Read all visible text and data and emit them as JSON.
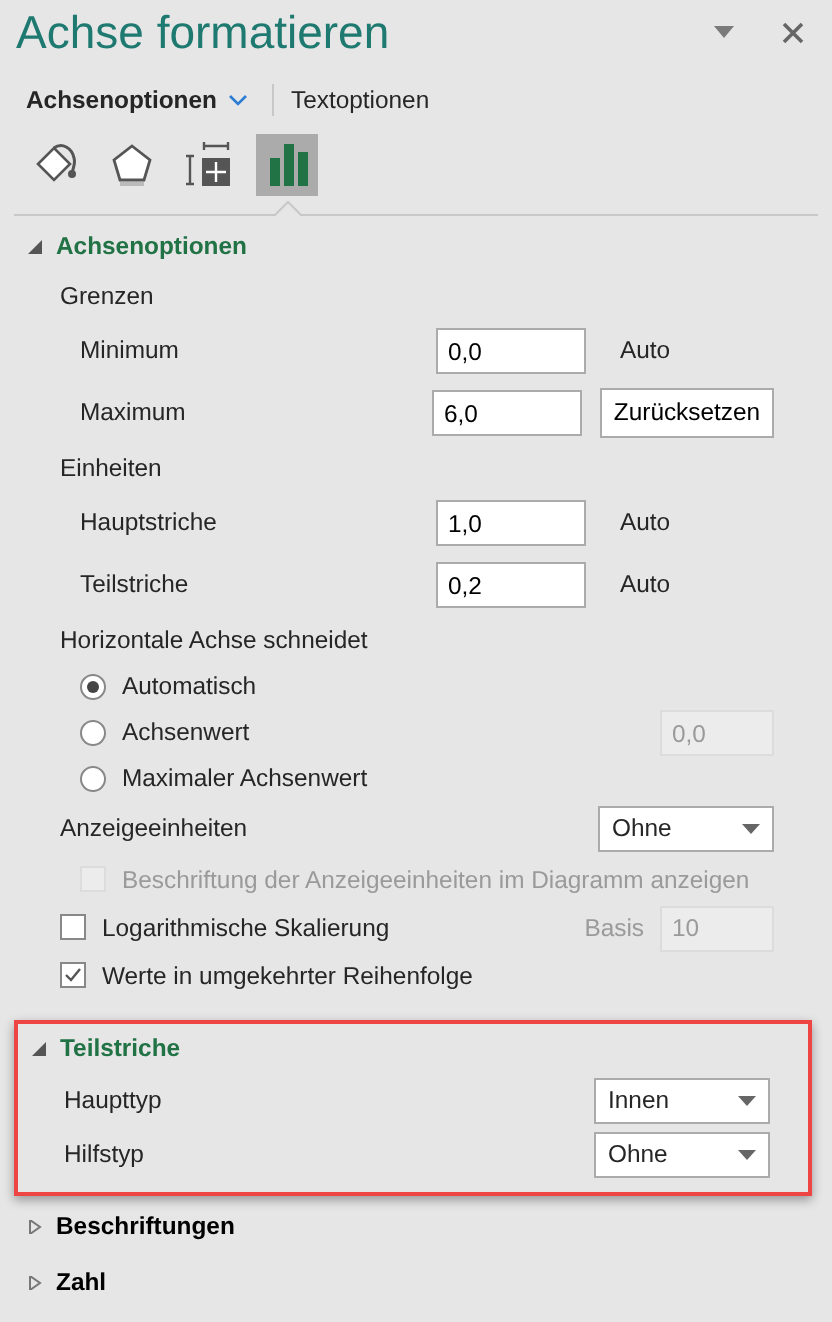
{
  "pane": {
    "title": "Achse formatieren",
    "tabs": [
      {
        "label": "Achsenoptionen",
        "selected": true
      },
      {
        "label": "Textoptionen",
        "selected": false
      }
    ],
    "icon_tabs": [
      {
        "kind": "fill",
        "selected": false
      },
      {
        "kind": "effects",
        "selected": false
      },
      {
        "kind": "size",
        "selected": false
      },
      {
        "kind": "axis",
        "selected": true
      }
    ]
  },
  "sections": [
    {
      "title": "Achsenoptionen",
      "expanded": true,
      "highlighted": false,
      "rows": [
        {
          "kind": "heading",
          "label": "Grenzen"
        },
        {
          "kind": "number",
          "label": "Minimum",
          "value": "0,0",
          "note": "Auto"
        },
        {
          "kind": "number",
          "label": "Maximum",
          "value": "6,0",
          "button": "Zurücksetzen"
        },
        {
          "kind": "heading",
          "label": "Einheiten"
        },
        {
          "kind": "number",
          "label": "Hauptstriche",
          "value": "1,0",
          "note": "Auto"
        },
        {
          "kind": "number",
          "label": "Teilstriche",
          "value": "0,2",
          "note": "Auto"
        },
        {
          "kind": "heading",
          "label": "Horizontale Achse schneidet"
        },
        {
          "kind": "radio",
          "label": "Automatisch",
          "selected": true
        },
        {
          "kind": "radio",
          "label": "Achsenwert",
          "selected": false,
          "field": "0,0"
        },
        {
          "kind": "radio",
          "label": "Maximaler Achsenwert",
          "selected": false
        },
        {
          "kind": "select",
          "label": "Anzeigeeinheiten",
          "value": "Ohne"
        },
        {
          "kind": "checkbox",
          "label": "Beschriftung der Anzeigeeinheiten im Diagramm anzeigen",
          "checked": false,
          "disabled": true
        },
        {
          "kind": "checkbox",
          "label": "Logarithmische Skalierung",
          "checked": false,
          "disabled": false,
          "field_label": "Basis",
          "field": "10"
        },
        {
          "kind": "checkbox",
          "label": "Werte in umgekehrter Reihenfolge",
          "checked": true,
          "disabled": false
        }
      ]
    },
    {
      "title": "Teilstriche",
      "expanded": true,
      "highlighted": true,
      "rows": [
        {
          "kind": "select",
          "label": "Haupttyp",
          "value": "Innen"
        },
        {
          "kind": "select",
          "label": "Hilfstyp",
          "value": "Ohne"
        }
      ]
    },
    {
      "title": "Beschriftungen",
      "expanded": false,
      "highlighted": false
    },
    {
      "title": "Zahl",
      "expanded": false,
      "highlighted": false
    }
  ]
}
